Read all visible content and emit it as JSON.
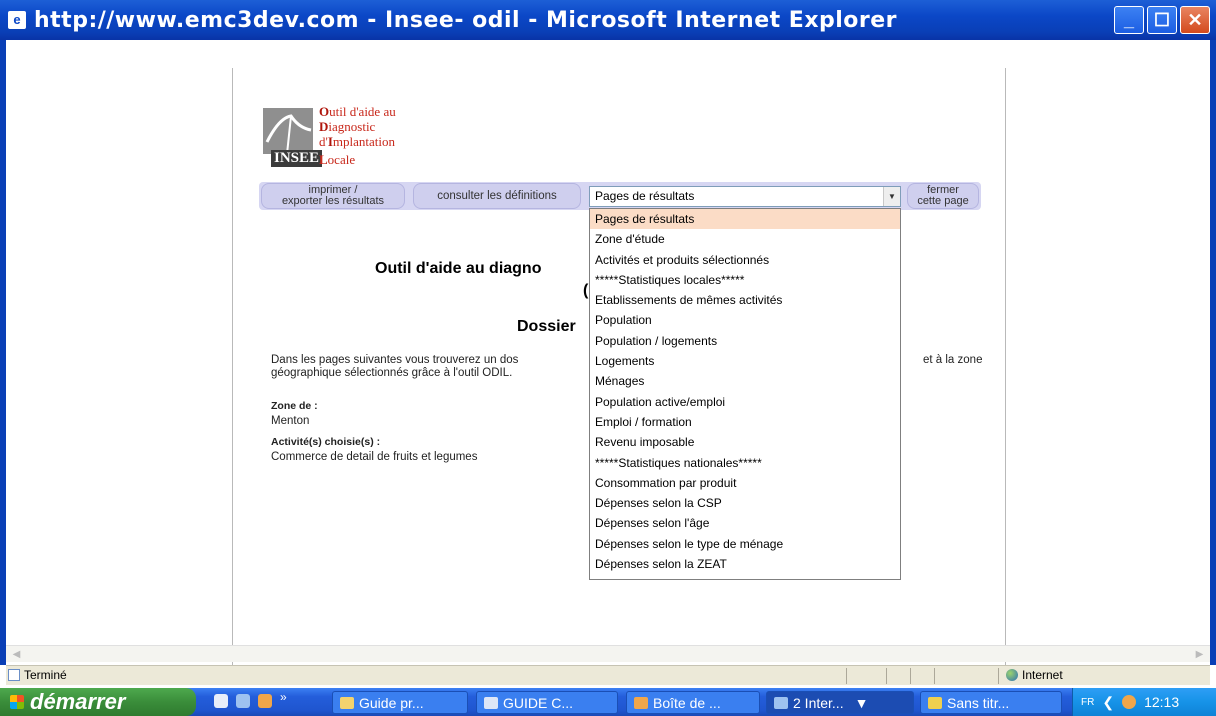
{
  "window": {
    "icon": "ie-page-icon",
    "title": "http://www.emc3dev.com - Insee- odil - Microsoft Internet Explorer",
    "controls": [
      "minimize-icon",
      "maximize-icon",
      "close-icon"
    ]
  },
  "logo": {
    "line1_initial": "O",
    "line1_rest": "util d'aide au",
    "line2_initial": "D",
    "line2_rest": "iagnostic",
    "line3_prefix": "d'",
    "line3_initial": "I",
    "line3_rest": "mplantation",
    "brand": "INSEE",
    "line4_initial": "L",
    "line4_rest": "ocale"
  },
  "toolbar": {
    "print_line1": "imprimer /",
    "print_line2": "exporter les résultats",
    "definitions": "consulter les définitions",
    "close_line1": "fermer",
    "close_line2": "cette page"
  },
  "select": {
    "selected": "Pages de résultats",
    "options": [
      "Pages de résultats",
      "Zone d'étude",
      "Activités et produits sélectionnés",
      "*****Statistiques locales*****",
      "Etablissements de mêmes activités",
      "Population",
      "Population / logements",
      "Logements",
      "Ménages",
      "Population active/emploi",
      "Emploi / formation",
      "Revenu imposable",
      "*****Statistiques nationales*****",
      "Consommation par produit",
      "Dépenses selon la CSP",
      "Dépenses selon l'âge",
      "Dépenses selon le type de ménage",
      "Dépenses selon la ZEAT"
    ]
  },
  "content": {
    "title": "Outil d'aide au diagno",
    "title_paren": "(",
    "dossier": "Dossier",
    "intro_line1": "Dans les pages suivantes vous trouverez un dos",
    "intro_line2": "géographique sélectionnés grâce à l'outil ODIL.",
    "intro_tail": "et à la zone",
    "zone_label": "Zone de :",
    "zone_value": "Menton",
    "activity_label": "Activité(s) choisie(s) :",
    "activity_value": "Commerce de detail de fruits et legumes"
  },
  "statusbar": {
    "status": "Terminé",
    "zone": "Internet"
  },
  "taskbar": {
    "start": "démarrer",
    "tasks": [
      "Guide pr...",
      "GUIDE C...",
      "Boîte de ...",
      "2 Inter...",
      "Sans titr..."
    ],
    "lang": "FR",
    "clock": "12:13"
  }
}
